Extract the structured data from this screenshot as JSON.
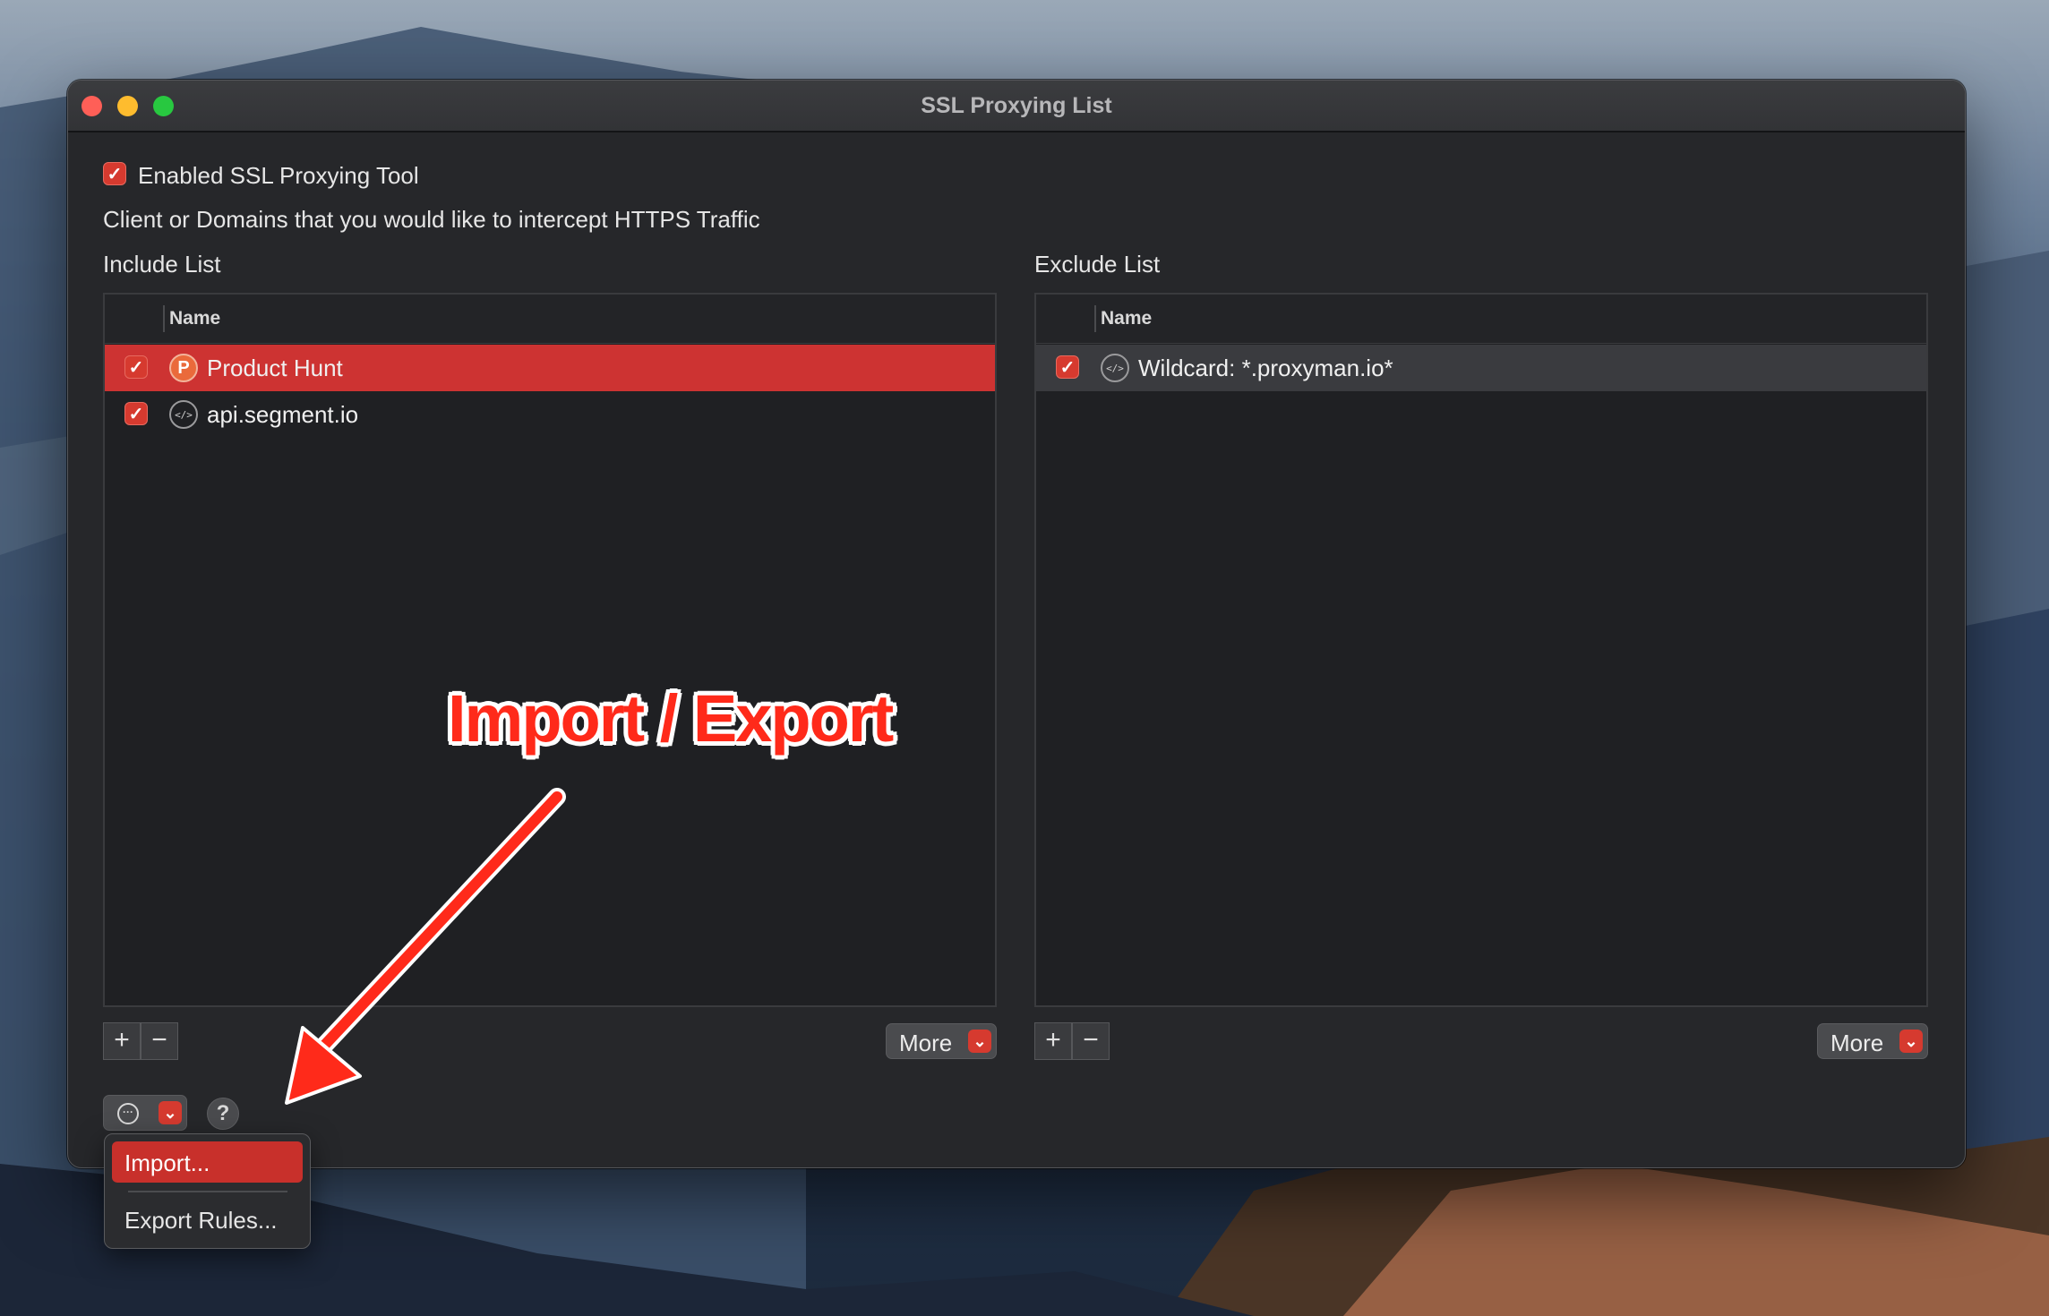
{
  "window": {
    "title": "SSL Proxying List"
  },
  "settings": {
    "enabled_label": "Enabled SSL Proxying Tool",
    "description": "Client or Domains that you would like to intercept HTTPS Traffic"
  },
  "include": {
    "title": "Include List",
    "column": "Name",
    "rows": [
      {
        "name": "Product Hunt",
        "icon": "P",
        "selected": true
      },
      {
        "name": "api.segment.io",
        "icon": "</>",
        "selected": false
      }
    ],
    "more_label": "More"
  },
  "exclude": {
    "title": "Exclude List",
    "column": "Name",
    "rows": [
      {
        "name": "Wildcard: *.proxyman.io*",
        "icon": "</>",
        "selected": true
      }
    ],
    "more_label": "More"
  },
  "controls": {
    "add": "+",
    "remove": "−",
    "help": "?"
  },
  "menu": {
    "import": "Import...",
    "export": "Export Rules..."
  },
  "annotation": {
    "text": "Import / Export",
    "color": "#ff2a1a"
  },
  "colors": {
    "accent": "#d63a2f",
    "selection": "#cd3332"
  }
}
